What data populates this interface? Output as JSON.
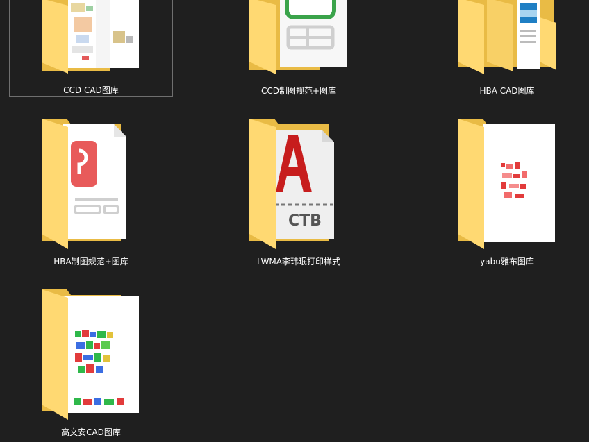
{
  "folders": [
    {
      "name": "CCD CAD图库",
      "preview": "cad-drawings",
      "selected": true
    },
    {
      "name": "CCD制图规范+图库",
      "preview": "spreadsheet-document"
    },
    {
      "name": "HBA CAD图库",
      "preview": "image-document"
    },
    {
      "name": "HBA制图规范+图库",
      "preview": "pdf-document"
    },
    {
      "name": "LWMA李玮珉打印样式",
      "preview": "autocad-ctb-file",
      "file_badge": "CTB"
    },
    {
      "name": "yabu雅布图库",
      "preview": "cad-drawing-red"
    },
    {
      "name": "高文安CAD图库",
      "preview": "cad-drawing-color"
    }
  ],
  "colors": {
    "background": "#1f1f1f",
    "folder_back": "#f2c94c",
    "folder_front": "#ffd972",
    "label": "#ffffff",
    "selection_border": "#6f6f6f"
  }
}
